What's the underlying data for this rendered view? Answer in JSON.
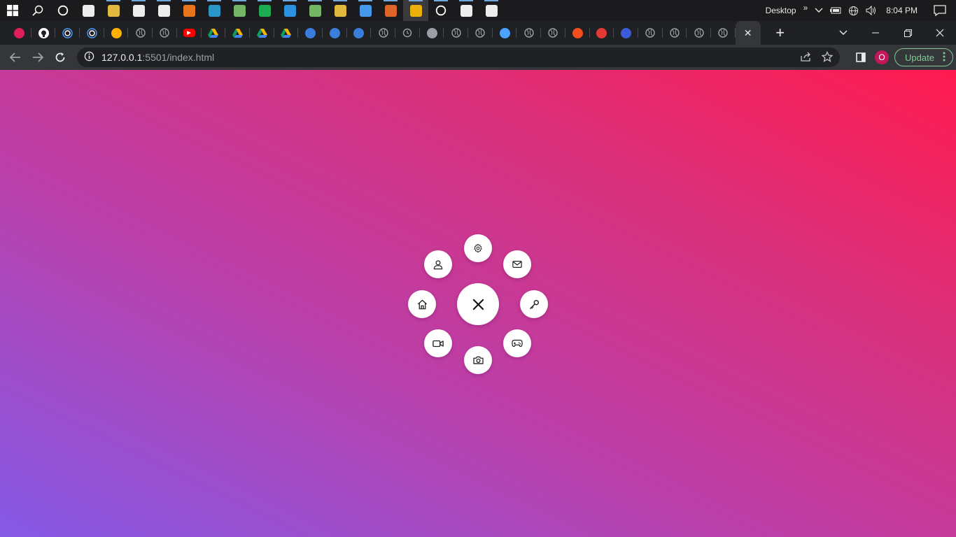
{
  "taskbar": {
    "apps": [
      {
        "icon": "windows-start-icon",
        "color": "#ffffff"
      },
      {
        "icon": "search-icon",
        "color": "#ffffff"
      },
      {
        "icon": "cortana-icon",
        "color": "#ffffff"
      },
      {
        "icon": "task-view-icon",
        "color": "#ffffff"
      },
      {
        "icon": "file-explorer-icon",
        "color": "#f4c542"
      },
      {
        "icon": "microsoft-store-icon",
        "color": "#ffffff"
      },
      {
        "icon": "mail-icon",
        "color": "#ffffff"
      },
      {
        "icon": "sublime-text-icon",
        "color": "#f97d1e"
      },
      {
        "icon": "edge-icon",
        "color": "#2aa3d8"
      },
      {
        "icon": "git-icon",
        "color": "#7cc36b"
      },
      {
        "icon": "spotify-icon",
        "color": "#1db954"
      },
      {
        "icon": "vscode-icon",
        "color": "#2e9bf0"
      },
      {
        "icon": "git-kraken-icon",
        "color": "#7cc36b"
      },
      {
        "icon": "python-icon",
        "color": "#f4c542"
      },
      {
        "icon": "browser-icon",
        "color": "#4aa3ff"
      },
      {
        "icon": "terminal-icon",
        "color": "#f06a2b"
      },
      {
        "icon": "chrome-icon",
        "color": "#fbbc05"
      },
      {
        "icon": "target-icon",
        "color": "#ffffff"
      },
      {
        "icon": "settings-icon",
        "color": "#ffffff"
      },
      {
        "icon": "usb-icon",
        "color": "#ffffff"
      }
    ],
    "tray": {
      "desktop_label": "Desktop",
      "more": "»",
      "time": "8:04 PM"
    }
  },
  "tabs": {
    "favicons": [
      {
        "icon": "slack-icon",
        "color": "#e01e5a"
      },
      {
        "icon": "github-icon",
        "color": "#ffffff"
      },
      {
        "icon": "target-icon",
        "color": "#4a9dff"
      },
      {
        "icon": "target-icon",
        "color": "#4a9dff"
      },
      {
        "icon": "xd-icon",
        "color": "#ffb000"
      },
      {
        "icon": "globe-icon",
        "color": "#9aa0a6"
      },
      {
        "icon": "globe-icon",
        "color": "#9aa0a6"
      },
      {
        "icon": "youtube-icon",
        "color": "#ff0000"
      },
      {
        "icon": "google-drive-icon",
        "color": "#fbbc05"
      },
      {
        "icon": "google-drive-icon",
        "color": "#fbbc05"
      },
      {
        "icon": "google-drive-icon",
        "color": "#fbbc05"
      },
      {
        "icon": "google-drive-icon",
        "color": "#fbbc05"
      },
      {
        "icon": "robot-icon",
        "color": "#3b7ddd"
      },
      {
        "icon": "robot-icon",
        "color": "#3b7ddd"
      },
      {
        "icon": "robot-icon",
        "color": "#3b7ddd"
      },
      {
        "icon": "globe-icon",
        "color": "#9aa0a6"
      },
      {
        "icon": "history-icon",
        "color": "#9aa0a6"
      },
      {
        "icon": "xd-icon",
        "color": "#9aa0a6"
      },
      {
        "icon": "globe-icon",
        "color": "#9aa0a6"
      },
      {
        "icon": "globe-icon",
        "color": "#9aa0a6"
      },
      {
        "icon": "browser-icon",
        "color": "#4aa3ff"
      },
      {
        "icon": "globe-icon",
        "color": "#9aa0a6"
      },
      {
        "icon": "globe-icon",
        "color": "#9aa0a6"
      },
      {
        "icon": "figma-icon",
        "color": "#f24e1e"
      },
      {
        "icon": "info-icon",
        "color": "#e53935"
      },
      {
        "icon": "shield-icon",
        "color": "#3b5bdb"
      },
      {
        "icon": "globe-icon",
        "color": "#9aa0a6"
      },
      {
        "icon": "globe-icon",
        "color": "#9aa0a6"
      },
      {
        "icon": "globe-icon",
        "color": "#9aa0a6"
      },
      {
        "icon": "globe-icon",
        "color": "#9aa0a6"
      }
    ],
    "active_close": "✕",
    "new_tab": "+"
  },
  "toolbar": {
    "url_host": "127.0.0.1",
    "url_path": ":5501/index.html",
    "avatar_letter": "O",
    "update_label": "Update"
  },
  "radial_menu": {
    "main_icon": "close-icon",
    "items": [
      "settings-icon",
      "mail-icon",
      "key-icon",
      "gamepad-icon",
      "camera-icon",
      "video-icon",
      "home-icon",
      "user-icon"
    ],
    "accent": "#ffffff"
  }
}
